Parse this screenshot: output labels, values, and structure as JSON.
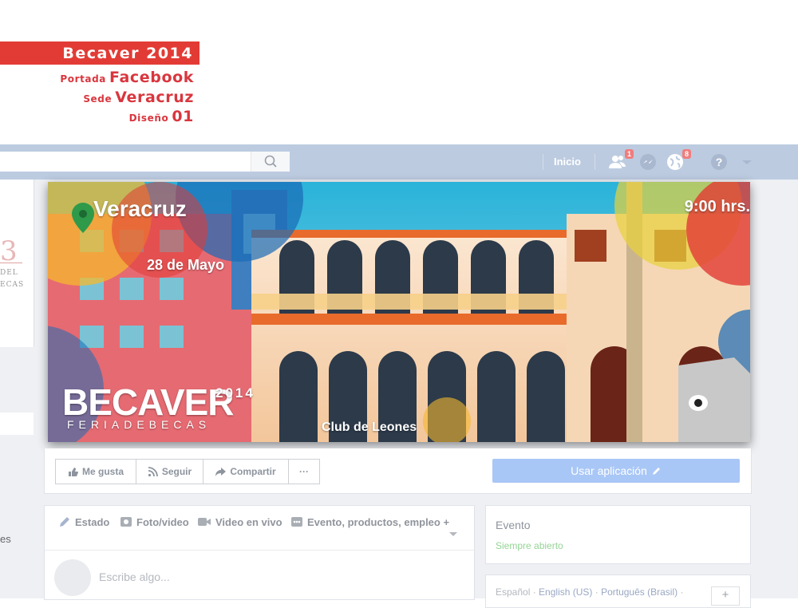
{
  "label": {
    "title": "Becaver 2014",
    "meta": [
      {
        "key": "Portada",
        "value": "Facebook"
      },
      {
        "key": "Sede",
        "value": "Veracruz"
      },
      {
        "key": "Diseño",
        "value": "01"
      }
    ]
  },
  "topbar": {
    "home": "Inicio",
    "friends_badge": "1",
    "notifications_badge": "8"
  },
  "left_partial": {
    "del": "DEL",
    "ecas": "ECAS",
    "es": "es"
  },
  "cover": {
    "city": "Veracruz",
    "date": "28 de Mayo",
    "time": "9:00 hrs.",
    "venue": "Club de Leones",
    "logo": "BECAVER",
    "logo_year": "2014",
    "logo_sub": "FERIADEBECAS"
  },
  "actions": {
    "like": "Me gusta",
    "follow": "Seguir",
    "share": "Compartir",
    "more": "···",
    "use_app": "Usar aplicación"
  },
  "composer": {
    "tabs": [
      "Estado",
      "Foto/video",
      "Video en vivo",
      "Evento, productos, empleo +"
    ],
    "placeholder": "Escribe algo..."
  },
  "right": {
    "event_title": "Evento",
    "status": "Siempre abierto",
    "languages": [
      "Español",
      "English (US)",
      "Português (Brasil)"
    ],
    "plus": "+"
  },
  "colors": {
    "brand_red": "#e23b35",
    "fb_bar": "#bccbe0",
    "use_app": "#a9c7f6"
  }
}
